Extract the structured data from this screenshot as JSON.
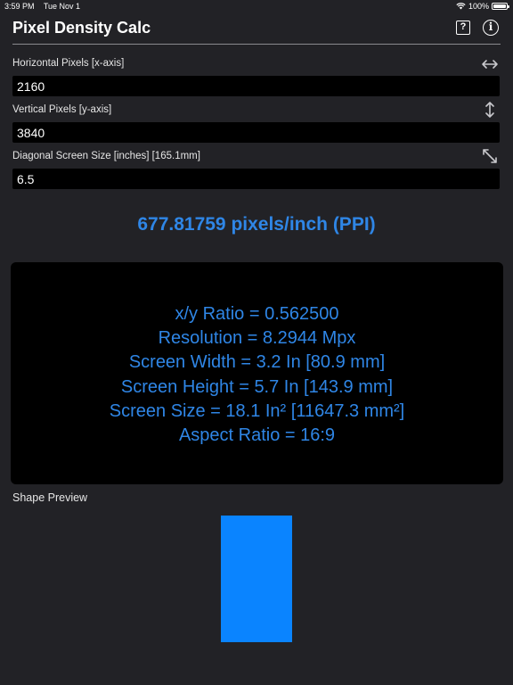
{
  "status_bar": {
    "time": "3:59 PM",
    "date": "Tue Nov 1",
    "battery": "100%"
  },
  "header": {
    "title": "Pixel Density Calc",
    "help_icon": "question-square-icon",
    "info_icon": "info-circle-icon"
  },
  "inputs": {
    "horizontal": {
      "label": "Horizontal Pixels  [x-axis]",
      "value": "2160",
      "icon": "horizontal-arrows-icon"
    },
    "vertical": {
      "label": "Vertical Pixels [y-axis]",
      "value": "3840",
      "icon": "vertical-arrows-icon"
    },
    "diagonal": {
      "label": "Diagonal Screen Size [inches] [165.1mm]",
      "value": "6.5",
      "icon": "diagonal-arrows-icon"
    }
  },
  "ppi_result": "677.81759 pixels/inch (PPI)",
  "results": [
    "x/y Ratio = 0.562500",
    "Resolution = 8.2944 Mpx",
    "Screen Width = 3.2 In [80.9 mm]",
    "Screen Height = 5.7 In [143.9 mm]",
    "Screen Size = 18.1 In² [11647.3 mm²]",
    "Aspect Ratio = 16:9"
  ],
  "preview": {
    "label": "Shape Preview",
    "color": "#0a84ff"
  },
  "colors": {
    "accent": "#2f86e6",
    "background": "#222226",
    "panel": "#000000"
  }
}
